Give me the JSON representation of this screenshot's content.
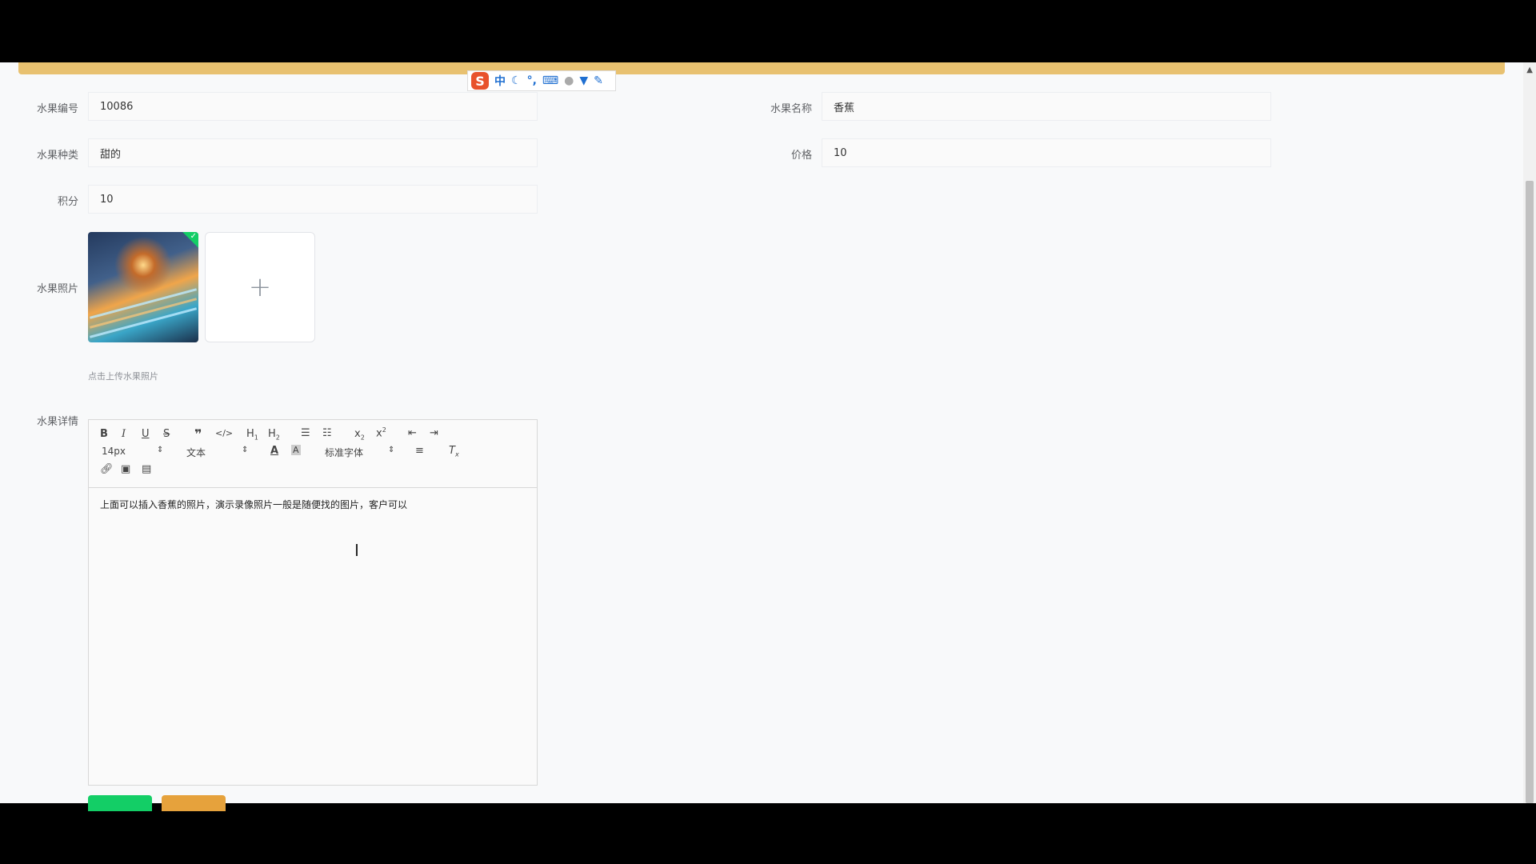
{
  "ime": {
    "logo": "S",
    "mode": "中",
    "icons": [
      "moon-icon",
      "punctuation-icon",
      "keyboard-icon",
      "user-icon",
      "skin-icon",
      "wrench-icon"
    ]
  },
  "form": {
    "fruit_id": {
      "label": "水果编号",
      "value": "10086"
    },
    "fruit_name": {
      "label": "水果名称",
      "value": "香蕉"
    },
    "fruit_type": {
      "label": "水果种类",
      "value": "甜的"
    },
    "price": {
      "label": "价格",
      "value": "10"
    },
    "points": {
      "label": "积分",
      "value": "10"
    },
    "photo": {
      "label": "水果照片",
      "hint": "点击上传水果照片",
      "add": "+"
    },
    "details": {
      "label": "水果详情",
      "font_size": "14px",
      "block_type": "文本",
      "font_family": "标准字体",
      "content": "上面可以插入香蕉的照片，演示录像照片一般是随便找的图片，客户可以"
    }
  },
  "colors": {
    "accent_bar": "#e8c170",
    "submit": "#13ce66",
    "cancel": "#e6a23c"
  }
}
